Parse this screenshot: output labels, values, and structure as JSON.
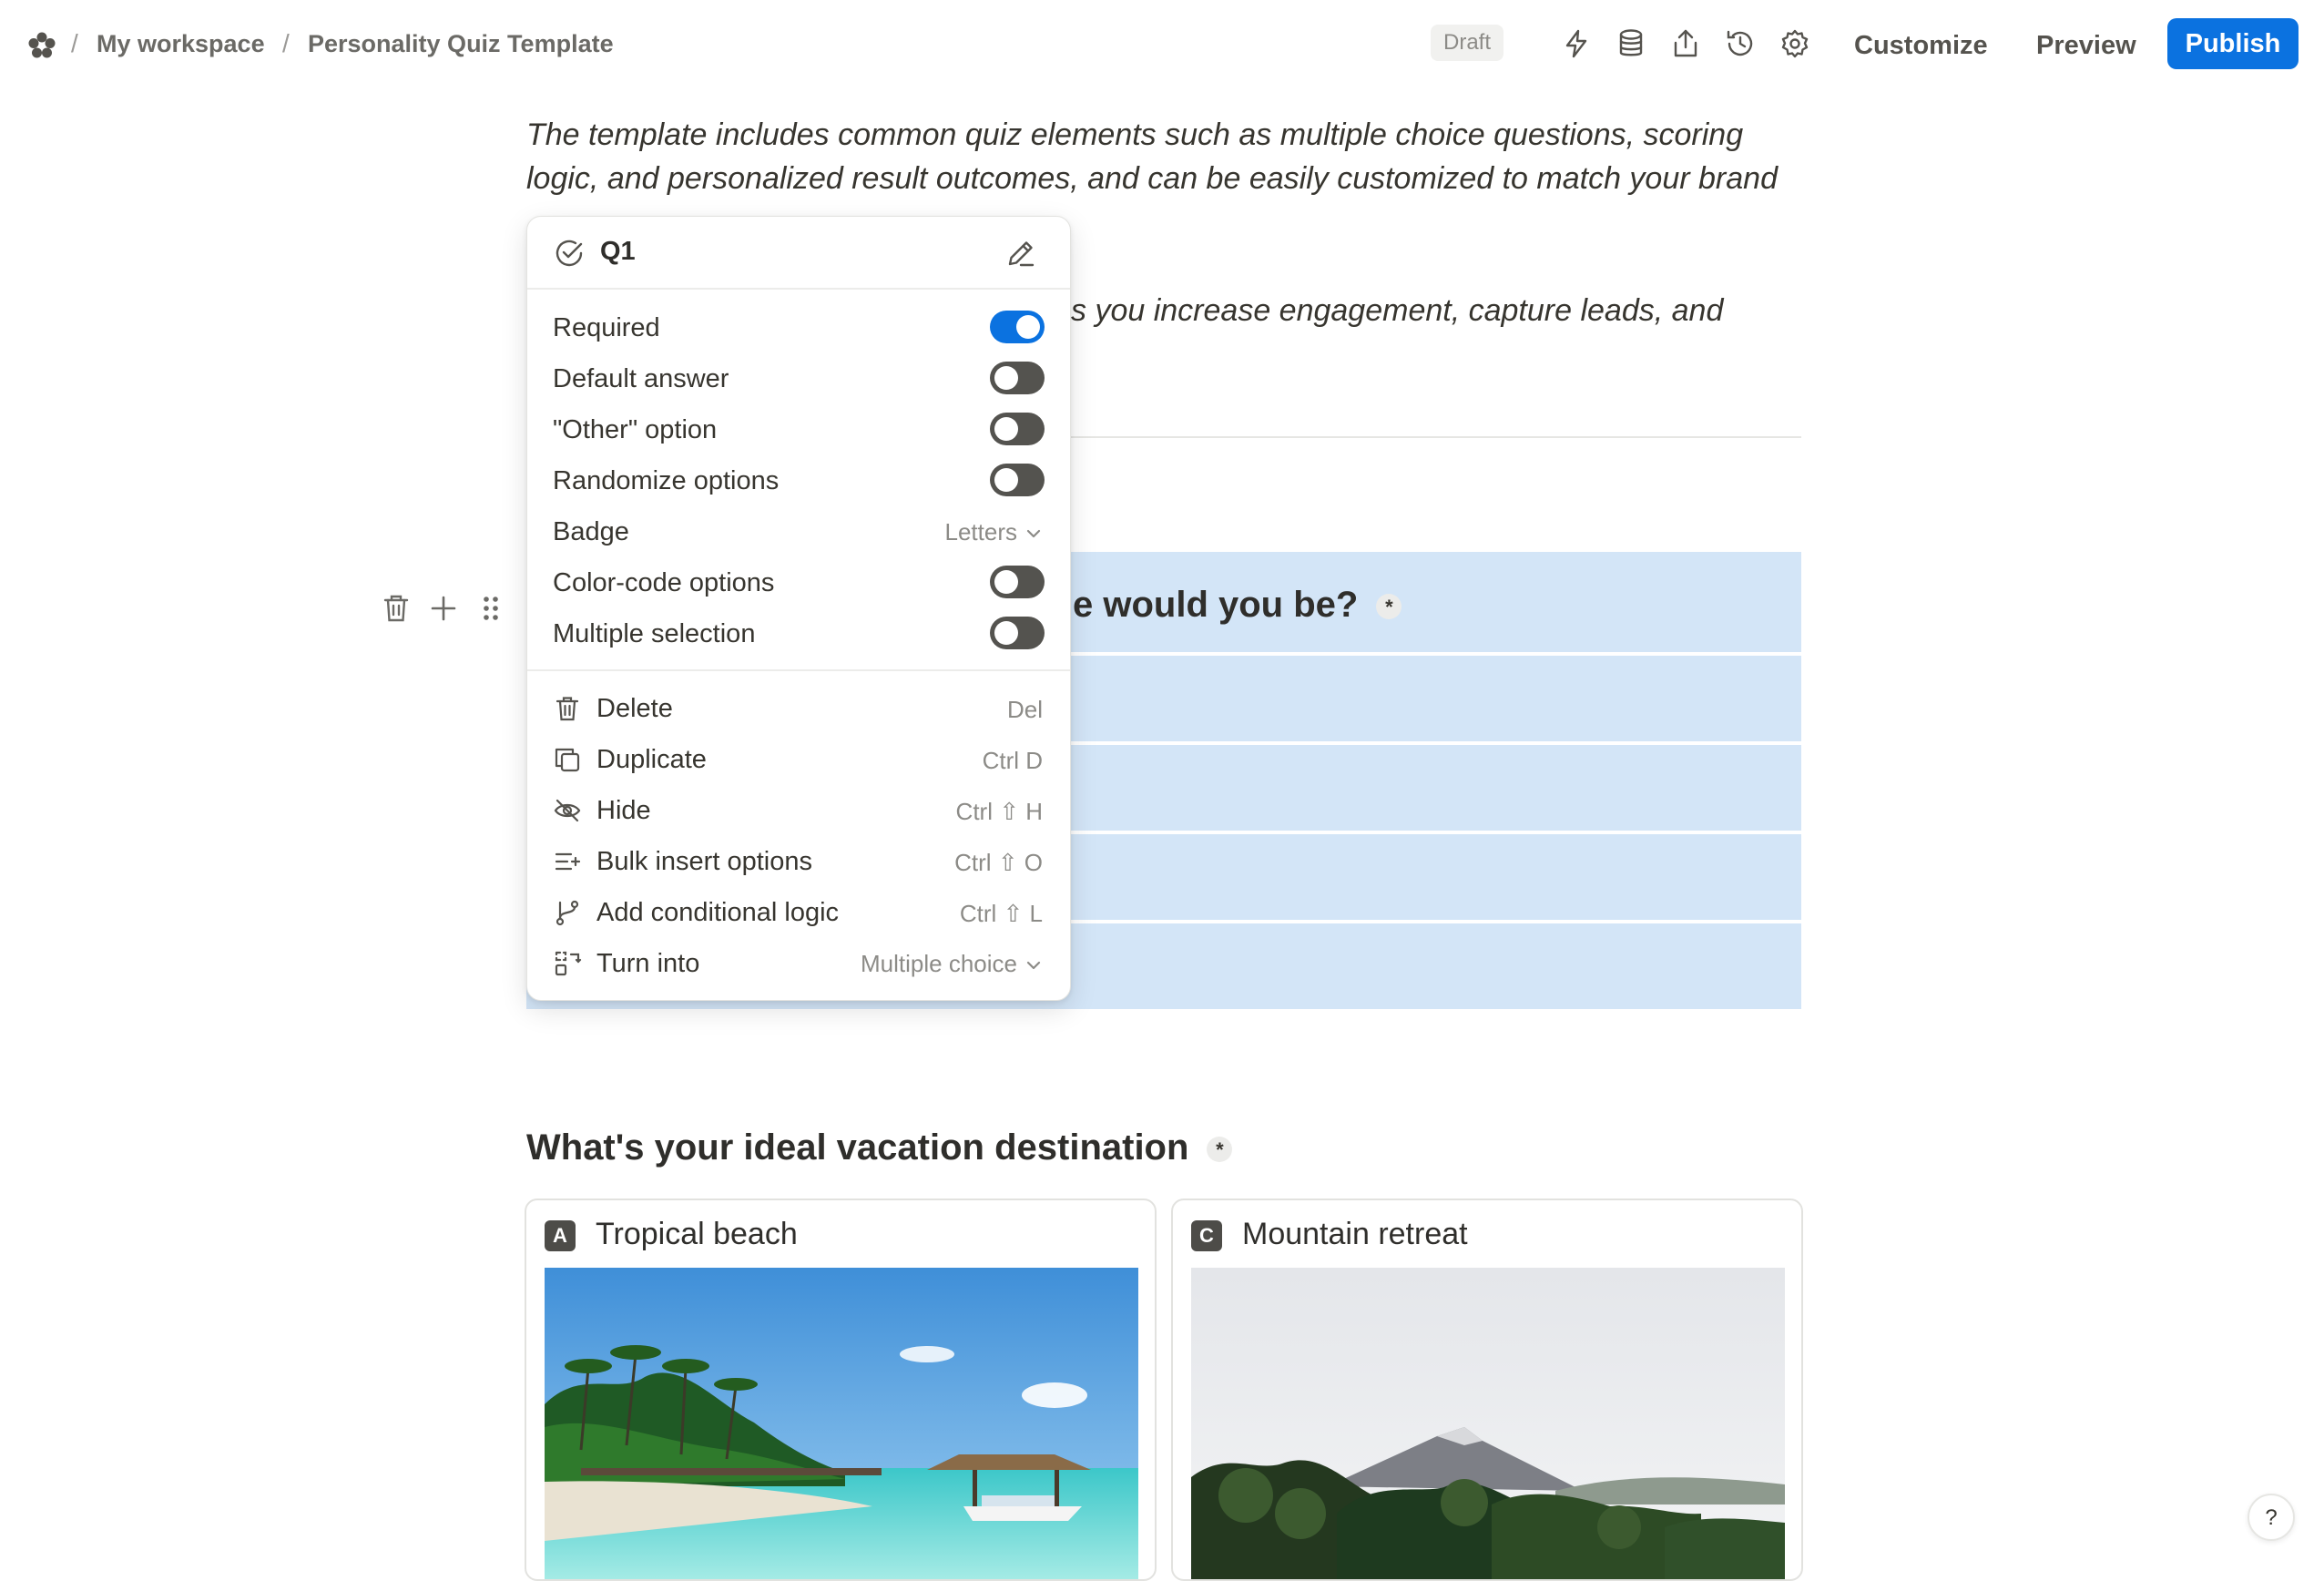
{
  "header": {
    "separator": "/",
    "workspace": "My workspace",
    "page": "Personality Quiz Template",
    "status": "Draft",
    "customize": "Customize",
    "preview": "Preview",
    "publish": "Publish"
  },
  "content": {
    "intro_line1": "The template includes common quiz elements such as multiple choice questions, scoring",
    "intro_line2": "logic, and personalized result outcomes, and can be easily customized to match your brand",
    "intro_line3_partial": "s you increase engagement, capture leads, and",
    "question1_title_partial": "e would you be?",
    "question2_title": "What's your ideal vacation destination",
    "required_mark": "*",
    "cards": [
      {
        "badge": "A",
        "label": "Tropical beach"
      },
      {
        "badge": "C",
        "label": "Mountain retreat"
      }
    ]
  },
  "menu": {
    "question_name": "Q1",
    "settings": [
      {
        "label": "Required",
        "on": true
      },
      {
        "label": "Default answer",
        "on": false
      },
      {
        "label": "\"Other\" option",
        "on": false
      },
      {
        "label": "Randomize options",
        "on": false
      },
      {
        "label": "Badge",
        "value": "Letters"
      },
      {
        "label": "Color-code options",
        "on": false
      },
      {
        "label": "Multiple selection",
        "on": false
      }
    ],
    "actions": [
      {
        "label": "Delete",
        "shortcut": "Del",
        "icon": "trash-icon"
      },
      {
        "label": "Duplicate",
        "shortcut": "Ctrl D",
        "icon": "duplicate-icon"
      },
      {
        "label": "Hide",
        "shortcut": "Ctrl ⇧ H",
        "icon": "eye-off-icon"
      },
      {
        "label": "Bulk insert options",
        "shortcut": "Ctrl ⇧ O",
        "icon": "list-plus-icon"
      },
      {
        "label": "Add conditional logic",
        "shortcut": "Ctrl ⇧ L",
        "icon": "branch-icon"
      },
      {
        "label": "Turn into",
        "value": "Multiple choice",
        "icon": "transform-icon"
      }
    ]
  },
  "help": "?"
}
